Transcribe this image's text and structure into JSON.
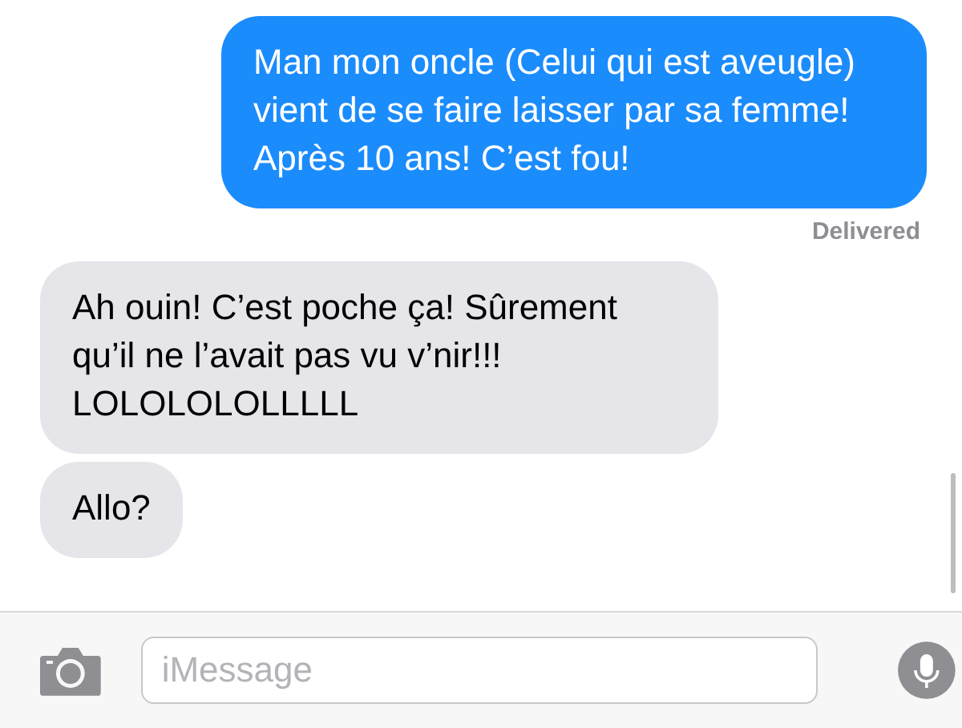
{
  "messages": [
    {
      "kind": "sent",
      "text": "Man mon oncle (Celui qui est aveugle) vient de se faire laisser par sa femme! Après 10 ans! C’est fou!"
    },
    {
      "kind": "status",
      "text": "Delivered"
    },
    {
      "kind": "received",
      "text": "Ah ouin! C’est poche ça! Sûrement qu’il ne l’avait pas vu v’nir!!! LOLOLOLOLLLLL"
    },
    {
      "kind": "received",
      "text": "Allo?"
    }
  ],
  "composer": {
    "placeholder": "iMessage"
  }
}
